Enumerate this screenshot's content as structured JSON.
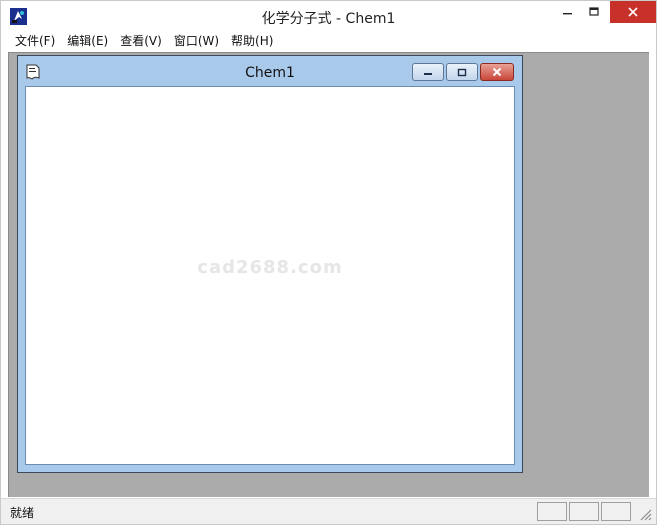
{
  "window": {
    "title": "化学分子式 - Chem1"
  },
  "menu": {
    "items": [
      {
        "label": "文件(F)"
      },
      {
        "label": "编辑(E)"
      },
      {
        "label": "查看(V)"
      },
      {
        "label": "窗口(W)"
      },
      {
        "label": "帮助(H)"
      }
    ]
  },
  "child_window": {
    "title": "Chem1",
    "watermark": "cad2688.com"
  },
  "status": {
    "text": "就绪"
  },
  "icons": {
    "app": "app-icon",
    "document": "doc-icon",
    "minimize": "minimize-icon",
    "maximize": "maximize-icon",
    "close": "close-icon",
    "restore": "restore-icon",
    "resize_grip": "resize-grip-icon"
  },
  "colors": {
    "close_button": "#c7312a",
    "mdi_background": "#ababab",
    "child_frame": "#a9c9ea"
  }
}
